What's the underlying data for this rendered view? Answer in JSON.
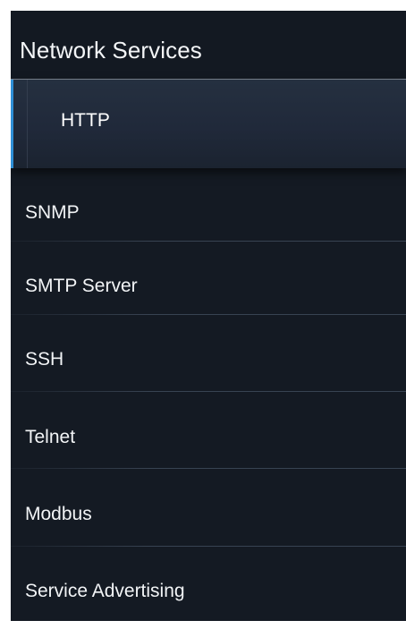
{
  "panel": {
    "title": "Network Services"
  },
  "menu": {
    "items": [
      {
        "label": "HTTP",
        "active": true
      },
      {
        "label": "SNMP",
        "active": false
      },
      {
        "label": "SMTP Server",
        "active": false
      },
      {
        "label": "SSH",
        "active": false
      },
      {
        "label": "Telnet",
        "active": false
      },
      {
        "label": "Modbus",
        "active": false
      },
      {
        "label": "Service Advertising",
        "active": false
      }
    ]
  },
  "colors": {
    "panel_background": "#141a23",
    "active_background": "#20293a",
    "active_indicator": "#2f8fd6",
    "text": "#f2f4f6",
    "divider": "#3a4556"
  }
}
